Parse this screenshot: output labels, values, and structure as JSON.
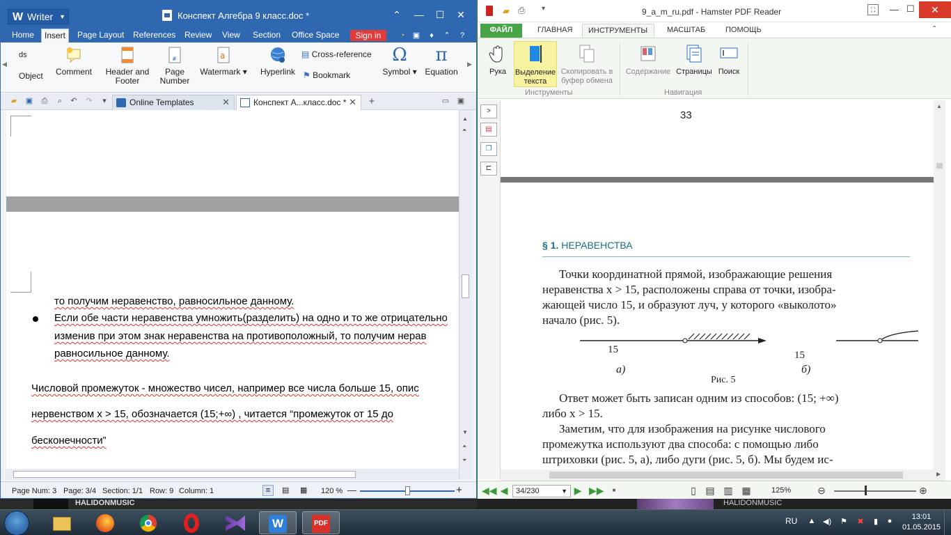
{
  "writer": {
    "app_name": "Writer",
    "doc_title": "Конспект Алгебра 9 класс.doc *",
    "menu": [
      "Home",
      "Insert",
      "Page Layout",
      "References",
      "Review",
      "View",
      "Section",
      "Office Space"
    ],
    "active_menu": "Insert",
    "sign_in": "Sign in",
    "ribbon": {
      "partial_left": "ds",
      "object": "Object",
      "comment": "Comment",
      "header_footer": "Header and Footer",
      "page_number": "Page Number",
      "watermark": "Watermark",
      "hyperlink": "Hyperlink",
      "cross_reference": "Cross-reference",
      "bookmark": "Bookmark",
      "symbol": "Symbol",
      "equation": "Equation"
    },
    "tabs": [
      {
        "label": "Online Templates"
      },
      {
        "label": "Конспект А...класс.doc *"
      }
    ],
    "body": {
      "line1": "то получим неравенство, равносильное данному.",
      "line2": "Если обе части неравенства умножить(разделить) на одно и то же отрицательно",
      "line3": "изменив при этом знак неравенства на противоположный, то получим нерав",
      "line4": "равносильное данному.",
      "line5": "Числовой промежуток - множество чисел, например все числа больше 15, опис",
      "line6": "нервенством  x  >  15,  обозначается    (15;+∞)  ,  читается  “промежуток  от  15  до",
      "line7": "бесконечности”"
    },
    "status": {
      "page_num": "Page Num: 3",
      "page": "Page: 3/4",
      "section": "Section: 1/1",
      "row": "Row: 9",
      "column": "Column: 1",
      "zoom": "120 %"
    }
  },
  "pdf": {
    "title": "9_a_m_ru.pdf - Hamster PDF Reader",
    "tabs": [
      "ФАЙЛ",
      "ГЛАВНАЯ",
      "ИНСТРУМЕНТЫ",
      "МАСШТАБ",
      "ПОМОЩЬ"
    ],
    "active_tab": "ИНСТРУМЕНТЫ",
    "ribbon": {
      "hand": "Рука",
      "select_text": "Выделение текста",
      "copy_clipboard": "Скопировать в буфер обмена",
      "group_tools": "Инструменты",
      "contents": "Содержание",
      "pages": "Страницы",
      "search": "Поиск",
      "group_nav": "Навигация"
    },
    "page_top_number": "33",
    "section_heading_num": "§ 1.",
    "section_heading": "НЕРАВЕНСТВА",
    "para1": [
      "Точки координатной прямой, изображающие решения",
      "неравенства x > 15, расположены справа от точки, изобра-",
      "жающей число 15, и образуют луч, у которого «выколото»",
      "начало (рис. 5)."
    ],
    "fig_label_a_num": "15",
    "fig_label_b_num": "15",
    "fig_a": "а)",
    "fig_b": "б)",
    "fig_caption": "Рис. 5",
    "para2": [
      "Ответ может быть записан одним из способов: (15; +∞)",
      "либо x > 15."
    ],
    "para3": [
      "Заметим, что для изображения на рисунке числового",
      "промежутка используют два способа: с помощью либо",
      "штриховки (рис. 5, а), либо дуги (рис. 5, б). Мы будем ис-"
    ],
    "page_box": "34/230",
    "zoom": "125%"
  },
  "background": {
    "music_label_left": "HALIDONMUSIC",
    "music_label_right": "HALIDONMUSIC"
  },
  "taskbar": {
    "lang": "RU",
    "time": "13:01",
    "date": "01.05.2015",
    "apps": [
      "explorer",
      "firefox",
      "chrome",
      "opera",
      "visual-studio",
      "wps-writer",
      "pdf-reader"
    ]
  },
  "colors": {
    "writer_blue": "#2f67b1",
    "pdf_green": "#47a447",
    "signin_red": "#e13b3b",
    "heading_teal": "#1a6d86"
  }
}
